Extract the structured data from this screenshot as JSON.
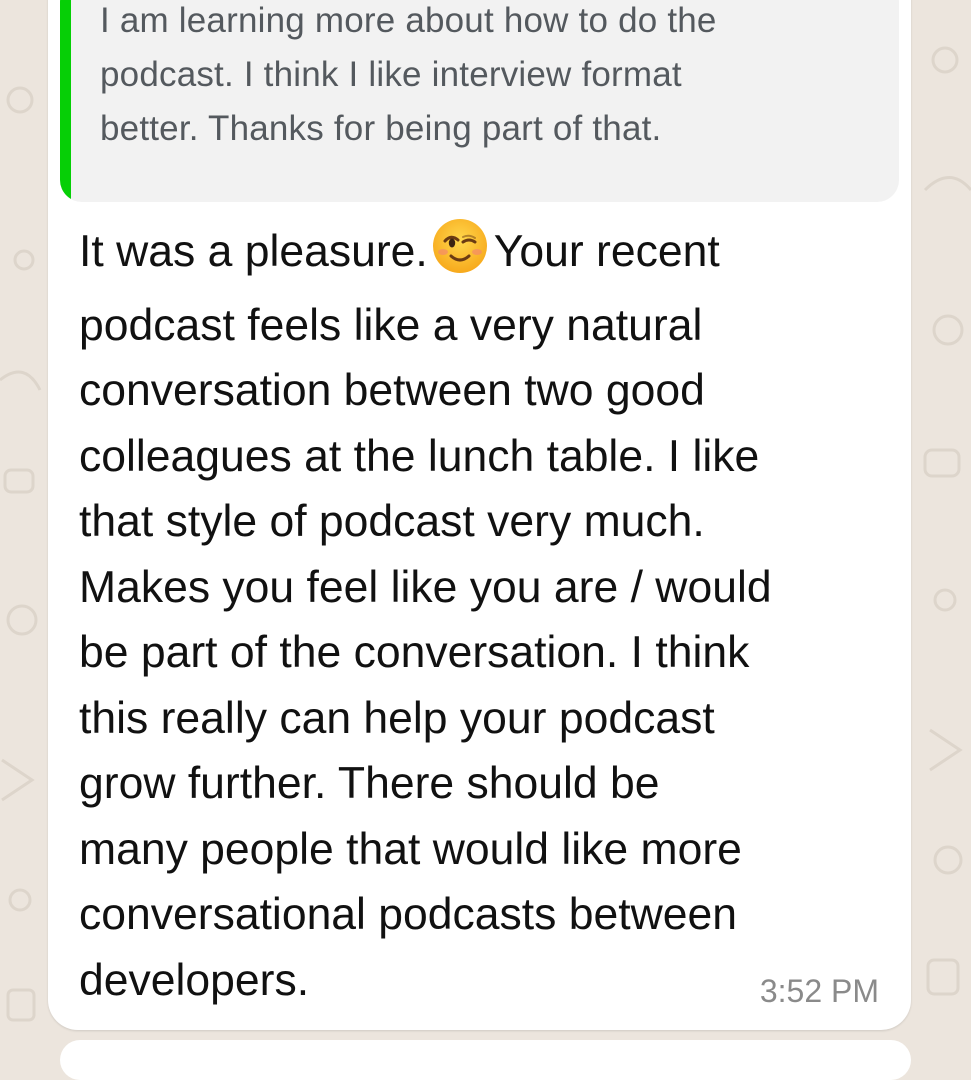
{
  "quoted_message": {
    "text": "I am learning more about how to do the\npodcast. I think I like interview format\nbetter. Thanks for being part of that."
  },
  "message": {
    "text_before_emoji": "It was a pleasure.",
    "emoji": "winking-face",
    "text_after_emoji": "Your recent\npodcast feels like a very natural\nconversation  between two good\ncolleagues at the lunch table. I like\nthat style of podcast very much.\nMakes you feel like you are / would\nbe part of the conversation. I think\nthis really can help your podcast\ngrow further. There should be\nmany people that would like more\nconversational podcasts between\ndevelopers.",
    "timestamp": "3:52 PM"
  },
  "colors": {
    "quote_bar": "#06cf06",
    "bubble": "#ffffff",
    "quote_background": "#f2f2f2",
    "wallpaper": "#ece5dd"
  }
}
